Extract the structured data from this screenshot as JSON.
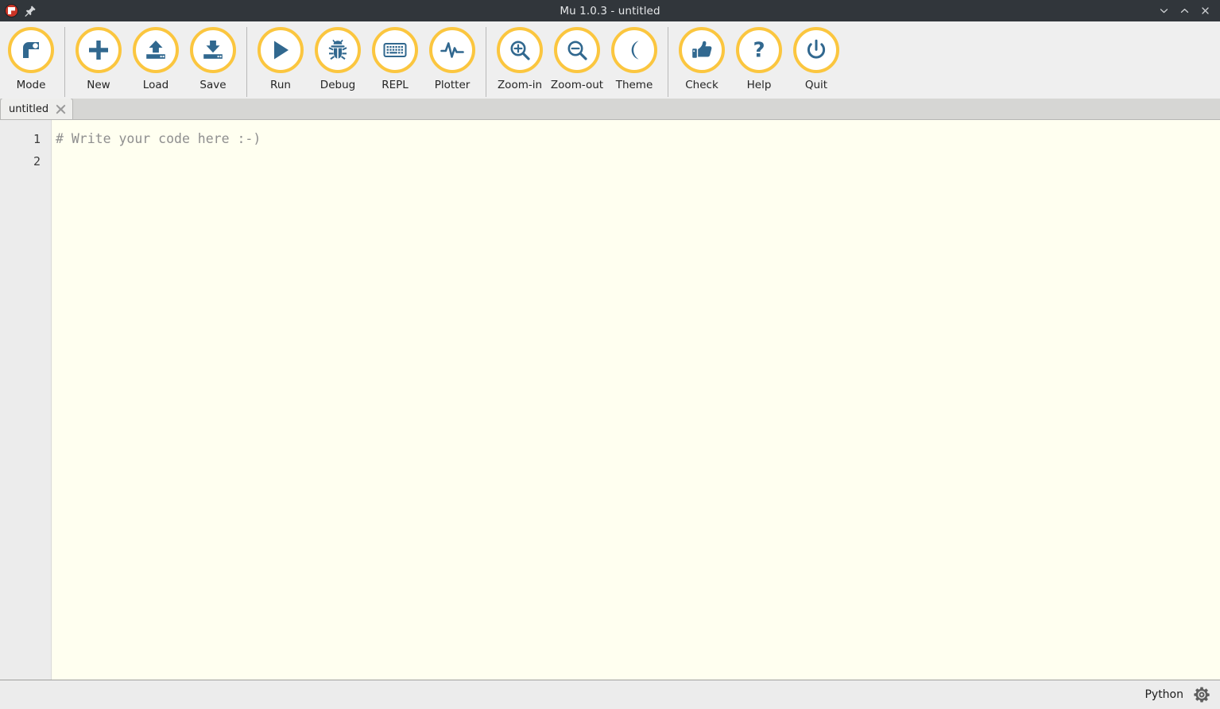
{
  "window": {
    "title": "Mu 1.0.3 - untitled",
    "app_icon": "mu-logo-icon",
    "pin_icon": "pin-icon",
    "controls": [
      {
        "name": "minimize-button",
        "icon": "chevron-down-icon"
      },
      {
        "name": "maximize-button",
        "icon": "chevron-up-icon"
      },
      {
        "name": "close-button",
        "icon": "close-icon"
      }
    ],
    "titlebar_bg": "#31363b",
    "titlebar_fg": "#e6e8ea"
  },
  "toolbar": {
    "accent_ring": "#fbc63f",
    "icon_color": "#31688f",
    "bg": "#efefef",
    "buttons": [
      {
        "label": "Mode",
        "icon": "mode-logo-icon"
      },
      {
        "label": "New",
        "icon": "plus-icon"
      },
      {
        "label": "Load",
        "icon": "upload-icon"
      },
      {
        "label": "Save",
        "icon": "download-icon"
      },
      {
        "label": "Run",
        "icon": "play-icon"
      },
      {
        "label": "Debug",
        "icon": "bug-icon"
      },
      {
        "label": "REPL",
        "icon": "keyboard-icon"
      },
      {
        "label": "Plotter",
        "icon": "pulse-icon"
      },
      {
        "label": "Zoom-in",
        "icon": "magnifier-plus-icon"
      },
      {
        "label": "Zoom-out",
        "icon": "magnifier-minus-icon"
      },
      {
        "label": "Theme",
        "icon": "moon-icon"
      },
      {
        "label": "Check",
        "icon": "thumbs-up-icon"
      },
      {
        "label": "Help",
        "icon": "question-mark-icon"
      },
      {
        "label": "Quit",
        "icon": "power-icon"
      }
    ]
  },
  "tabs": [
    {
      "label": "untitled",
      "close_icon": "close-icon",
      "active": true
    }
  ],
  "editor": {
    "line_numbers": [
      "1",
      "2"
    ],
    "lines": [
      "# Write your code here :-)",
      ""
    ],
    "background": "#fffff0",
    "gutter_background": "#ececec",
    "comment_color": "#8f8f8f"
  },
  "statusbar": {
    "mode": "Python",
    "gear_icon": "gear-icon"
  }
}
